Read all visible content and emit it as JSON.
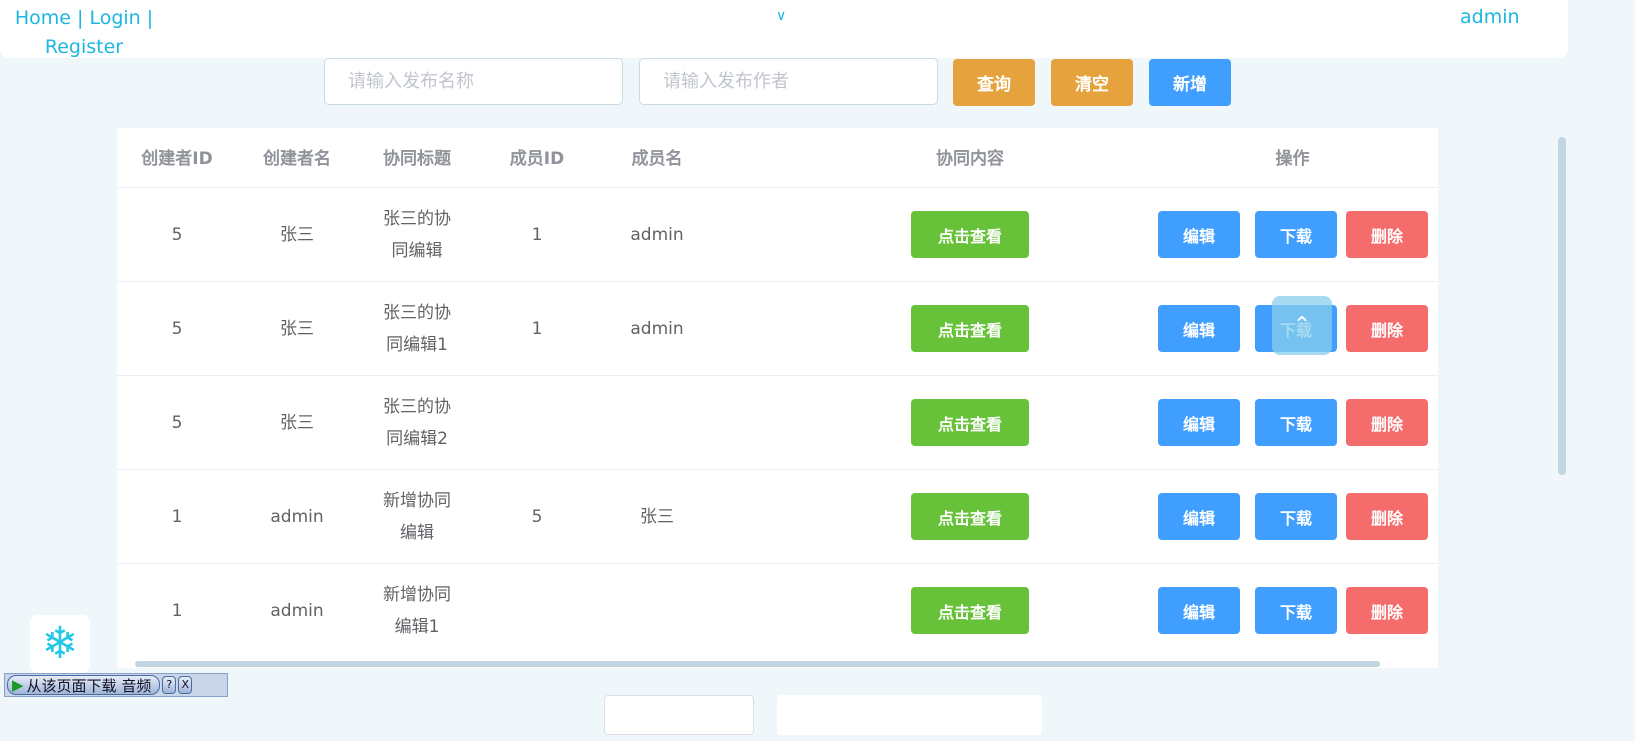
{
  "header": {
    "home": "Home",
    "login": "Login",
    "register": "Register",
    "user": "admin"
  },
  "search": {
    "name_placeholder": "请输入发布名称",
    "author_placeholder": "请输入发布作者",
    "query": "查询",
    "clear": "清空",
    "add": "新增"
  },
  "table": {
    "headers": [
      "创建者ID",
      "创建者名",
      "协同标题",
      "成员ID",
      "成员名",
      "协同内容",
      "操作"
    ],
    "rows": [
      {
        "creator_id": "5",
        "creator_name": "张三",
        "title": "张三的协同编辑",
        "member_id": "1",
        "member_name": "admin"
      },
      {
        "creator_id": "5",
        "creator_name": "张三",
        "title": "张三的协同编辑1",
        "member_id": "1",
        "member_name": "admin"
      },
      {
        "creator_id": "5",
        "creator_name": "张三",
        "title": "张三的协同编辑2",
        "member_id": "",
        "member_name": ""
      },
      {
        "creator_id": "1",
        "creator_name": "admin",
        "title": "新增协同编辑",
        "member_id": "5",
        "member_name": "张三"
      },
      {
        "creator_id": "1",
        "creator_name": "admin",
        "title": "新增协同编辑1",
        "member_id": "",
        "member_name": ""
      }
    ],
    "view_label": "点击查看",
    "edit_label": "编辑",
    "download_label": "下载",
    "delete_label": "删除"
  },
  "audio_bar": {
    "label": "从该页面下载 音频",
    "help": "?",
    "close": "X"
  }
}
